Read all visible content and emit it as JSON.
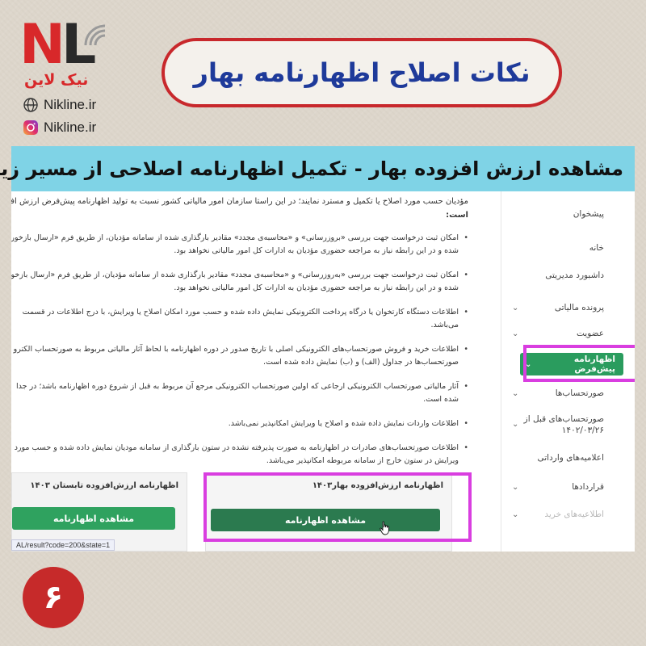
{
  "logo": {
    "letters_n": "N",
    "letters_l": "L",
    "brand_fa": "نیک لاین",
    "website": "Nikline.ir",
    "instagram": "Nikline.ir",
    "accent": "#d8282a"
  },
  "title": "نکات اصلاح اظهارنامه بهار",
  "banner": "مشاهده ارزش افزوده بهار - تکمیل اظهارنامه اصلاحی از مسیر زیر :",
  "content": {
    "intro_lines": [
      "مؤدیان حسب مورد اصلاح یا تکمیل و مسترد نمایند؛ در این راستا سازمان امور مالیاتی کشور نسبت به تولید اظهارنامه پیش‌فرض ارزش افزوده به",
      "است:"
    ],
    "bullets": [
      {
        "lines": [
          "امکان ثبت درخواست جهت بررسی «بروزرسانی» و «محاسبه‌ی مجدد» مقادیر بارگذاری شده از سامانه مؤدیان، از طریق فرم «ارسال بازخورد»",
          "شده و در این رابطه نیاز به مراجعه حضوری مؤدیان به ادارات کل امور مالیاتی نخواهد بود."
        ]
      },
      {
        "lines": [
          "امکان ثبت درخواست جهت بررسی «به‌روزرسانی» و «محاسبه‌ی مجدد» مقادیر بارگذاری شده از سامانه مؤدیان، از طریق فرم «ارسال بازخورد»",
          "شده و در این رابطه نیاز به مراجعه حضوری مؤدیان به ادارات کل امور مالیاتی نخواهد بود."
        ]
      },
      {
        "lines": [
          "اطلاعات دستگاه کارتخوان یا درگاه پرداخت الکترونیکی نمایش داده شده و حسب مورد امکان اصلاح یا ویرایش، با درج اطلاعات در قسمت",
          "می‌باشد."
        ]
      },
      {
        "lines": [
          "اطلاعات خرید و فروش صورتحساب‌های الکترونیکی اصلی با تاریخ صدور در دوره اظهارنامه با لحاظ آثار مالیاتی مربوط به صورتحساب الکترو",
          "صورتحساب‌ها در جداول (الف) و (ب) نمایش داده شده است."
        ]
      },
      {
        "lines": [
          "آثار مالیاتی صورتحساب الکترونیکی ارجاعی که اولین صورتحساب الکترونیکی مرجع آن مربوط به قبل از شروع دوره اظهارنامه باشد؛ در جدا",
          "شده است."
        ]
      },
      {
        "lines": [
          "اطلاعات واردات نمایش داده شده و اصلاح یا ویرایش امکانپذیر نمی‌باشد."
        ]
      },
      {
        "lines": [
          "اطلاعات صورتحساب‌های صادرات در اظهارنامه به صورت پذیرفته نشده در ستون بارگذاری از سامانه مودیان نمایش داده شده و حسب مورد",
          "ویرایش در ستون خارج از سامانه مربوطه امکانپذیر می‌باشد."
        ]
      }
    ],
    "card_left": {
      "title": "اظهارنامه ارزش‌افزوده تابستان ۱۴۰۳",
      "button": "مشاهده اظهارنامه"
    },
    "card_right": {
      "title": "اظهارنامه ارزش‌افزوده بهار۱۴۰۳",
      "button": "مشاهده اظهارنامه"
    },
    "url": "AL/result?code=200&state=1"
  },
  "sidebar": {
    "items": [
      {
        "label": "پیشخوان",
        "chevron": false
      },
      {
        "label": "خانه",
        "chevron": false
      },
      {
        "label": "داشبورد مدیریتی",
        "chevron": false
      },
      {
        "label": "پرونده مالیاتی",
        "chevron": true
      },
      {
        "label": "عضویت",
        "chevron": true
      },
      {
        "label": "اظهارنامه پیش‌فرض",
        "chevron": true,
        "active": true
      },
      {
        "label": "صورتحساب‌ها",
        "chevron": true
      },
      {
        "label": "صورتحساب‌های قبل از",
        "label2": "۱۴۰۲/۰۳/۲۶",
        "chevron": true
      },
      {
        "label": "اعلامیه‌های وارداتی",
        "chevron": false
      },
      {
        "label": "قراردادها",
        "chevron": true
      },
      {
        "label": "اطلاعیه‌های خرید",
        "chevron": true,
        "disabled": true
      }
    ],
    "accent": "#2a9c5e"
  },
  "page_number": "۶",
  "colors": {
    "title_text": "#1e3a9a",
    "title_border": "#c8282c",
    "banner_bg": "#7fd3e6",
    "highlight": "#d93ee0",
    "badge_bg": "#c62a2a"
  }
}
